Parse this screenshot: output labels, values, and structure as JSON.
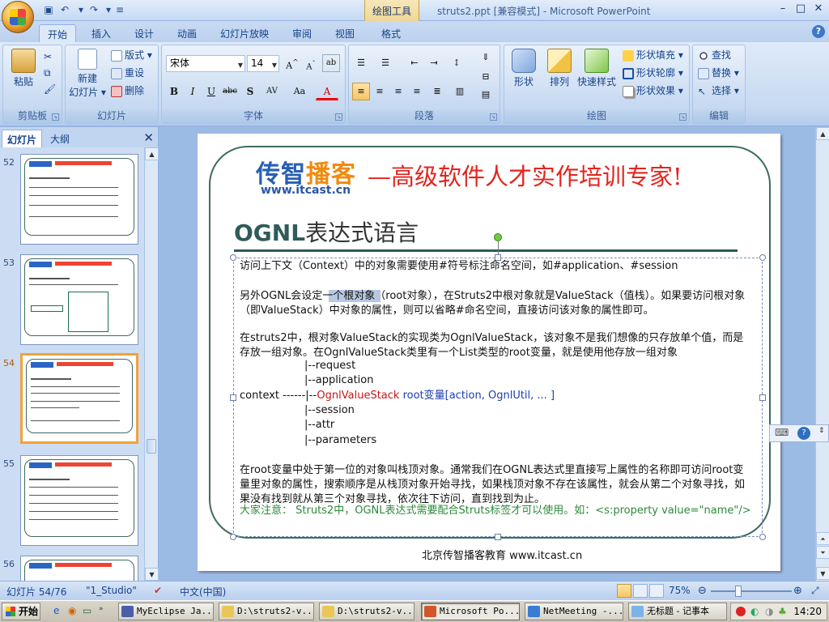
{
  "window": {
    "title": "struts2.ppt [兼容模式] - Microsoft PowerPoint",
    "context_tab_title": "绘图工具",
    "controls": {
      "minimize": "–",
      "maximize": "□",
      "close": "✕"
    }
  },
  "tabs": [
    "开始",
    "插入",
    "设计",
    "动画",
    "幻灯片放映",
    "审阅",
    "视图",
    "格式"
  ],
  "active_tab": "开始",
  "ribbon": {
    "clipboard": {
      "label": "剪贴板",
      "paste": "粘贴"
    },
    "slides": {
      "label": "幻灯片",
      "new_slide_line1": "新建",
      "new_slide_line2": "幻灯片 ▾",
      "layout": "版式 ▾",
      "reset": "重设",
      "delete": "删除"
    },
    "font": {
      "label": "字体",
      "font_name": "宋体",
      "font_size": "14",
      "bold": "B",
      "italic": "I",
      "underline": "U",
      "strike": "abc",
      "shadow": "S",
      "spacing": "AV",
      "case": "Aa",
      "color": "A"
    },
    "paragraph": {
      "label": "段落"
    },
    "drawing": {
      "label": "绘图",
      "shapes": "形状",
      "arrange": "排列",
      "quick_styles": "快速样式",
      "fill": "形状填充 ▾",
      "outline": "形状轮廓 ▾",
      "effects": "形状效果 ▾"
    },
    "editing": {
      "label": "编辑",
      "find": "查找",
      "replace": "替换 ▾",
      "select": "选择 ▾"
    }
  },
  "left_pane": {
    "tab_slides": "幻灯片",
    "tab_outline": "大纲",
    "slide_numbers": [
      "52",
      "53",
      "54",
      "55",
      "56"
    ],
    "selected_slide": "54"
  },
  "slide": {
    "logo_part1": "传智",
    "logo_part2": "播客",
    "logo_url": "www.itcast.cn",
    "slogan": "—高级软件人才实作培训专家!",
    "title_bold": "OGNL",
    "title_rest": "表达式语言",
    "para1": "访问上下文（Context）中的对象需要使用#符号标注命名空间，如#application、#session",
    "para2": "另外OGNL会设定一个根对象（root对象），在Struts2中根对象就是ValueStack（值栈）。如果要访问根对象（即ValueStack）中对象的属性，则可以省略#命名空间，直接访问该对象的属性即可。",
    "para3": "在struts2中，根对象ValueStack的实现类为OgnlValueStack，该对象不是我们想像的只存放单个值，而是存放一组对象。在OgnlValueStack类里有一个List类型的root变量，就是使用他存放一组对象",
    "struct": {
      "request": "|--request",
      "application": "|--application",
      "context_prefix": "context ------|--",
      "ognl_stack": "OgnlValueStack",
      "root_part": " root变量[action, OgnlUtil, ... ]",
      "session": "|--session",
      "attr": "|--attr",
      "parameters": "|--parameters"
    },
    "para4": "在root变量中处于第一位的对象叫栈顶对象。通常我们在OGNL表达式里直接写上属性的名称即可访问root变量里对象的属性，搜索顺序是从栈顶对象开始寻找，如果栈顶对象不存在该属性，就会从第二个对象寻找，如果没有找到就从第三个对象寻找，依次往下访问，直到找到为止。",
    "note": "大家注意： Struts2中，OGNL表达式需要配合Struts标签才可以使用。如：<s:property value=\"name\"/>",
    "footer": "北京传智播客教育 www.itcast.cn"
  },
  "status_bar": {
    "slide_counter": "幻灯片 54/76",
    "theme": "\"1_Studio\"",
    "language": "中文(中国)",
    "zoom": "75%"
  },
  "taskbar": {
    "start": "开始",
    "tasks": [
      "MyEclipse Ja...",
      "D:\\struts2-v...",
      "D:\\struts2-v...",
      "Microsoft Po...",
      "NetMeeting -...",
      "无标题 - 记事本"
    ],
    "active_task": "Microsoft Po...",
    "clock": "14:20"
  },
  "colors": {
    "slide_frame": "#3f6b62",
    "slogan_red": "#e2261f",
    "logo_blue": "#2760b4",
    "logo_orange": "#f08b12",
    "note_green": "#2b8a3a",
    "ognl_red": "#c3181a",
    "root_blue": "#1b3eb3"
  }
}
